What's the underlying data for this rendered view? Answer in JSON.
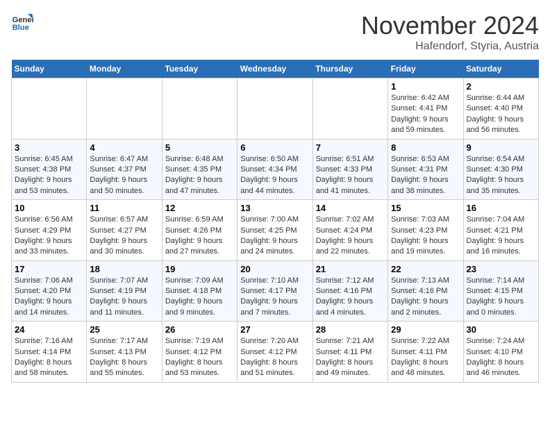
{
  "header": {
    "logo_line1": "General",
    "logo_line2": "Blue",
    "month": "November 2024",
    "location": "Hafendorf, Styria, Austria"
  },
  "weekdays": [
    "Sunday",
    "Monday",
    "Tuesday",
    "Wednesday",
    "Thursday",
    "Friday",
    "Saturday"
  ],
  "weeks": [
    [
      {
        "day": "",
        "info": ""
      },
      {
        "day": "",
        "info": ""
      },
      {
        "day": "",
        "info": ""
      },
      {
        "day": "",
        "info": ""
      },
      {
        "day": "",
        "info": ""
      },
      {
        "day": "1",
        "info": "Sunrise: 6:42 AM\nSunset: 4:41 PM\nDaylight: 9 hours and 59 minutes."
      },
      {
        "day": "2",
        "info": "Sunrise: 6:44 AM\nSunset: 4:40 PM\nDaylight: 9 hours and 56 minutes."
      }
    ],
    [
      {
        "day": "3",
        "info": "Sunrise: 6:45 AM\nSunset: 4:38 PM\nDaylight: 9 hours and 53 minutes."
      },
      {
        "day": "4",
        "info": "Sunrise: 6:47 AM\nSunset: 4:37 PM\nDaylight: 9 hours and 50 minutes."
      },
      {
        "day": "5",
        "info": "Sunrise: 6:48 AM\nSunset: 4:35 PM\nDaylight: 9 hours and 47 minutes."
      },
      {
        "day": "6",
        "info": "Sunrise: 6:50 AM\nSunset: 4:34 PM\nDaylight: 9 hours and 44 minutes."
      },
      {
        "day": "7",
        "info": "Sunrise: 6:51 AM\nSunset: 4:33 PM\nDaylight: 9 hours and 41 minutes."
      },
      {
        "day": "8",
        "info": "Sunrise: 6:53 AM\nSunset: 4:31 PM\nDaylight: 9 hours and 38 minutes."
      },
      {
        "day": "9",
        "info": "Sunrise: 6:54 AM\nSunset: 4:30 PM\nDaylight: 9 hours and 35 minutes."
      }
    ],
    [
      {
        "day": "10",
        "info": "Sunrise: 6:56 AM\nSunset: 4:29 PM\nDaylight: 9 hours and 33 minutes."
      },
      {
        "day": "11",
        "info": "Sunrise: 6:57 AM\nSunset: 4:27 PM\nDaylight: 9 hours and 30 minutes."
      },
      {
        "day": "12",
        "info": "Sunrise: 6:59 AM\nSunset: 4:26 PM\nDaylight: 9 hours and 27 minutes."
      },
      {
        "day": "13",
        "info": "Sunrise: 7:00 AM\nSunset: 4:25 PM\nDaylight: 9 hours and 24 minutes."
      },
      {
        "day": "14",
        "info": "Sunrise: 7:02 AM\nSunset: 4:24 PM\nDaylight: 9 hours and 22 minutes."
      },
      {
        "day": "15",
        "info": "Sunrise: 7:03 AM\nSunset: 4:23 PM\nDaylight: 9 hours and 19 minutes."
      },
      {
        "day": "16",
        "info": "Sunrise: 7:04 AM\nSunset: 4:21 PM\nDaylight: 9 hours and 16 minutes."
      }
    ],
    [
      {
        "day": "17",
        "info": "Sunrise: 7:06 AM\nSunset: 4:20 PM\nDaylight: 9 hours and 14 minutes."
      },
      {
        "day": "18",
        "info": "Sunrise: 7:07 AM\nSunset: 4:19 PM\nDaylight: 9 hours and 11 minutes."
      },
      {
        "day": "19",
        "info": "Sunrise: 7:09 AM\nSunset: 4:18 PM\nDaylight: 9 hours and 9 minutes."
      },
      {
        "day": "20",
        "info": "Sunrise: 7:10 AM\nSunset: 4:17 PM\nDaylight: 9 hours and 7 minutes."
      },
      {
        "day": "21",
        "info": "Sunrise: 7:12 AM\nSunset: 4:16 PM\nDaylight: 9 hours and 4 minutes."
      },
      {
        "day": "22",
        "info": "Sunrise: 7:13 AM\nSunset: 4:16 PM\nDaylight: 9 hours and 2 minutes."
      },
      {
        "day": "23",
        "info": "Sunrise: 7:14 AM\nSunset: 4:15 PM\nDaylight: 9 hours and 0 minutes."
      }
    ],
    [
      {
        "day": "24",
        "info": "Sunrise: 7:16 AM\nSunset: 4:14 PM\nDaylight: 8 hours and 58 minutes."
      },
      {
        "day": "25",
        "info": "Sunrise: 7:17 AM\nSunset: 4:13 PM\nDaylight: 8 hours and 55 minutes."
      },
      {
        "day": "26",
        "info": "Sunrise: 7:19 AM\nSunset: 4:12 PM\nDaylight: 8 hours and 53 minutes."
      },
      {
        "day": "27",
        "info": "Sunrise: 7:20 AM\nSunset: 4:12 PM\nDaylight: 8 hours and 51 minutes."
      },
      {
        "day": "28",
        "info": "Sunrise: 7:21 AM\nSunset: 4:11 PM\nDaylight: 8 hours and 49 minutes."
      },
      {
        "day": "29",
        "info": "Sunrise: 7:22 AM\nSunset: 4:11 PM\nDaylight: 8 hours and 48 minutes."
      },
      {
        "day": "30",
        "info": "Sunrise: 7:24 AM\nSunset: 4:10 PM\nDaylight: 8 hours and 46 minutes."
      }
    ]
  ]
}
